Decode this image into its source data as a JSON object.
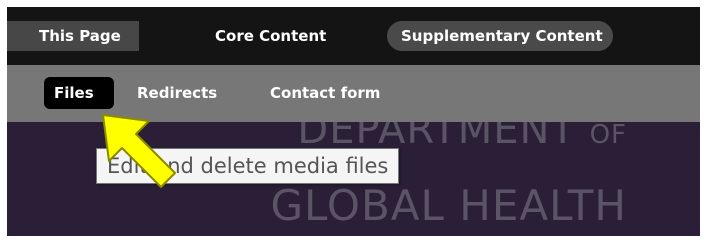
{
  "top_nav": {
    "tabs": [
      {
        "label": "This Page"
      },
      {
        "label": "Core Content"
      },
      {
        "label": "Supplementary Content"
      }
    ]
  },
  "sub_nav": {
    "items": [
      {
        "label": "Files"
      },
      {
        "label": "Redirects"
      },
      {
        "label": "Contact form"
      }
    ]
  },
  "logo": {
    "line1": "DEPARTMENT",
    "line1_suffix": "OF",
    "line2": "GLOBAL HEALTH"
  },
  "tooltip": {
    "text": "Edit and delete media files"
  },
  "pointer": {
    "icon": "arrow-pointer-icon",
    "color": "#ffff00"
  }
}
